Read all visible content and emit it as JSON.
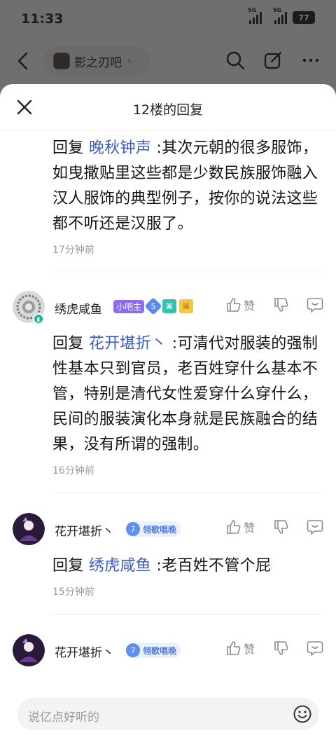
{
  "status_bar": {
    "time": "11:33",
    "signal1": "5G",
    "signal2": "5G",
    "battery": "77"
  },
  "background": {
    "forum_name": "影之刃吧",
    "chevron": "›"
  },
  "sheet": {
    "title": "12楼的回复",
    "input_placeholder": "说亿点好听的"
  },
  "replies": [
    {
      "prefix": "回复",
      "mention": "晚秋钟声",
      "text": " :其次元朝的很多服饰，如曳撒贴里这些都是少数民族服饰融入汉人服饰的典型例子，按你的说法这些都不听还是汉服了。",
      "time": "17分钟前"
    },
    {
      "username": "绣虎咸鱼",
      "role_badge": "小吧主",
      "level": "5",
      "like_label": "赞",
      "prefix": "回复",
      "mention": "花开堪折丶",
      "text": " :可清代对服装的强制性基本只到官员，老百姓穿什么基本不管，特别是清代女性爱穿什么穿什么，民间的服装演化本身就是民族融合的结果，没有所谓的强制。",
      "time": "16分钟前"
    },
    {
      "username": "花开堪折丶",
      "group_level": "7",
      "group_name": "翎歌唱晚",
      "like_label": "赞",
      "prefix": "回复",
      "mention": "绣虎咸鱼",
      "text": " :老百姓不管个屁",
      "time": "15分钟前"
    },
    {
      "username": "花开堪折丶",
      "group_level": "7",
      "group_name": "翎歌唱晚",
      "like_label": "赞"
    }
  ],
  "colors": {
    "mention": "#3b5bb8",
    "accent_purple": "#8b6cf0",
    "level_blue": "#5a8cf0"
  }
}
